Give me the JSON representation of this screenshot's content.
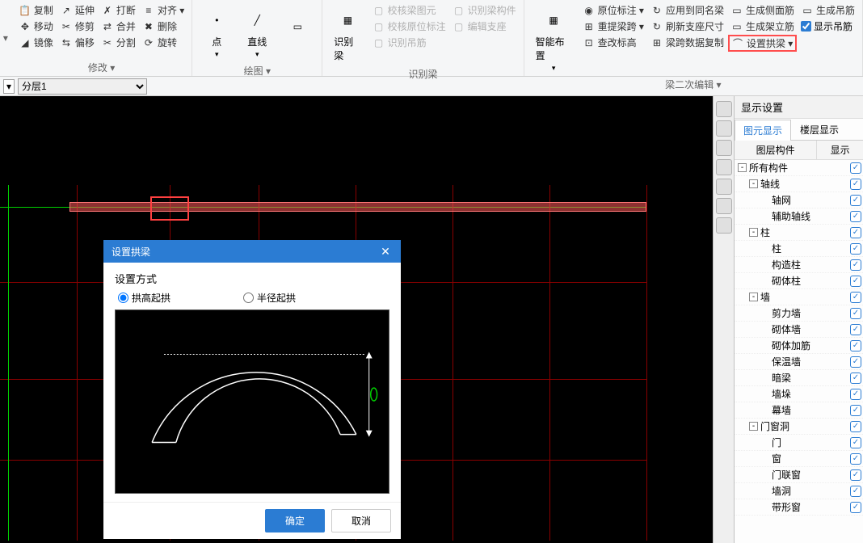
{
  "ribbon": {
    "modify": {
      "label": "修改 ▾",
      "items": [
        "复制",
        "移动",
        "镜像",
        "延伸",
        "修剪",
        "偏移",
        "打断",
        "合并",
        "分割",
        "对齐 ▾",
        "删除",
        "旋转"
      ]
    },
    "draw": {
      "label": "绘图 ▾",
      "point": "点",
      "line": "直线"
    },
    "identify": {
      "label": "识别梁",
      "main": "识别梁",
      "items": [
        "校核梁图元",
        "校核原位标注",
        "识别吊筋",
        "识别梁构件",
        "编辑支座"
      ]
    },
    "smart": "智能布置",
    "edit2": {
      "label": "梁二次编辑 ▾",
      "col1": [
        "原位标注 ▾",
        "重提梁跨 ▾",
        "查改标高"
      ],
      "col2": [
        "应用到同名梁",
        "刷新支座尺寸",
        "梁跨数据复制"
      ],
      "col3": [
        "生成侧面筋",
        "生成架立筋"
      ],
      "col4": [
        "生成吊筋",
        "显示吊筋"
      ],
      "arch": "设置拱梁 ▾"
    }
  },
  "layer": {
    "current": "分层1"
  },
  "rpanel": {
    "title": "显示设置",
    "tab1": "图元显示",
    "tab2": "楼层显示",
    "h1": "图层构件",
    "h2": "显示",
    "tree": [
      {
        "d": 0,
        "tw": "-",
        "lbl": "所有构件"
      },
      {
        "d": 1,
        "tw": "-",
        "lbl": "轴线"
      },
      {
        "d": 2,
        "tw": "",
        "lbl": "轴网"
      },
      {
        "d": 2,
        "tw": "",
        "lbl": "辅助轴线"
      },
      {
        "d": 1,
        "tw": "-",
        "lbl": "柱"
      },
      {
        "d": 2,
        "tw": "",
        "lbl": "柱"
      },
      {
        "d": 2,
        "tw": "",
        "lbl": "构造柱"
      },
      {
        "d": 2,
        "tw": "",
        "lbl": "砌体柱"
      },
      {
        "d": 1,
        "tw": "-",
        "lbl": "墙"
      },
      {
        "d": 2,
        "tw": "",
        "lbl": "剪力墙"
      },
      {
        "d": 2,
        "tw": "",
        "lbl": "砌体墙"
      },
      {
        "d": 2,
        "tw": "",
        "lbl": "砌体加筋"
      },
      {
        "d": 2,
        "tw": "",
        "lbl": "保温墙"
      },
      {
        "d": 2,
        "tw": "",
        "lbl": "暗梁"
      },
      {
        "d": 2,
        "tw": "",
        "lbl": "墙垛"
      },
      {
        "d": 2,
        "tw": "",
        "lbl": "幕墙"
      },
      {
        "d": 1,
        "tw": "-",
        "lbl": "门窗洞"
      },
      {
        "d": 2,
        "tw": "",
        "lbl": "门"
      },
      {
        "d": 2,
        "tw": "",
        "lbl": "窗"
      },
      {
        "d": 2,
        "tw": "",
        "lbl": "门联窗"
      },
      {
        "d": 2,
        "tw": "",
        "lbl": "墙洞"
      },
      {
        "d": 2,
        "tw": "",
        "lbl": "带形窗"
      }
    ]
  },
  "dialog": {
    "title": "设置拱梁",
    "section": "设置方式",
    "opt1": "拱高起拱",
    "opt2": "半径起拱",
    "ok": "确定",
    "cancel": "取消"
  }
}
